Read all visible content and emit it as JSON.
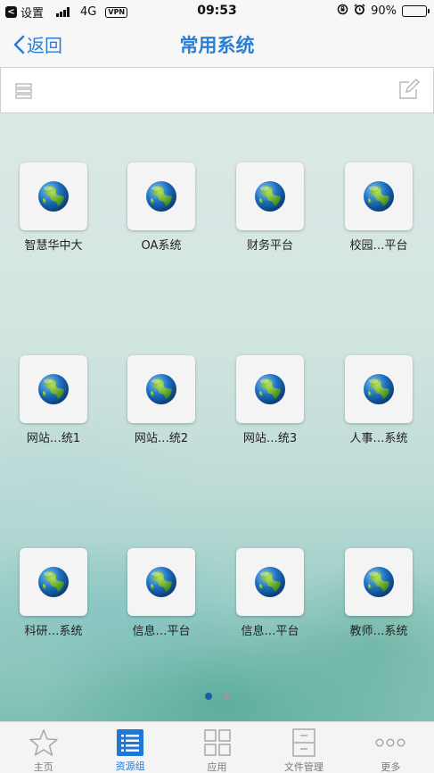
{
  "status_bar": {
    "back_app": "设置",
    "network": "4G",
    "vpn": "VPN",
    "time": "09:53",
    "battery": "90%",
    "battery_level": 0.9
  },
  "nav": {
    "back_label": "返回",
    "title": "常用系统"
  },
  "apps": [
    {
      "label": "智慧华中大"
    },
    {
      "label": "OA系统"
    },
    {
      "label": "财务平台"
    },
    {
      "label": "校园…平台"
    },
    {
      "label": "网站…统1"
    },
    {
      "label": "网站…统2"
    },
    {
      "label": "网站…统3"
    },
    {
      "label": "人事…系统"
    },
    {
      "label": "科研…系统"
    },
    {
      "label": "信息…平台"
    },
    {
      "label": "信息…平台"
    },
    {
      "label": "教师…系统"
    }
  ],
  "pagination": {
    "current": 1,
    "total": 2
  },
  "tabs": [
    {
      "label": "主页",
      "icon": "star-icon"
    },
    {
      "label": "资源组",
      "icon": "list-icon",
      "active": true
    },
    {
      "label": "应用",
      "icon": "grid-icon"
    },
    {
      "label": "文件管理",
      "icon": "cabinet-icon"
    },
    {
      "label": "更多",
      "icon": "more-icon"
    }
  ],
  "colors": {
    "accent": "#2a7fd4",
    "active_tab": "#1f78d6",
    "dot_active": "#1a5f9e",
    "dot_inactive": "#8f9d9b"
  }
}
